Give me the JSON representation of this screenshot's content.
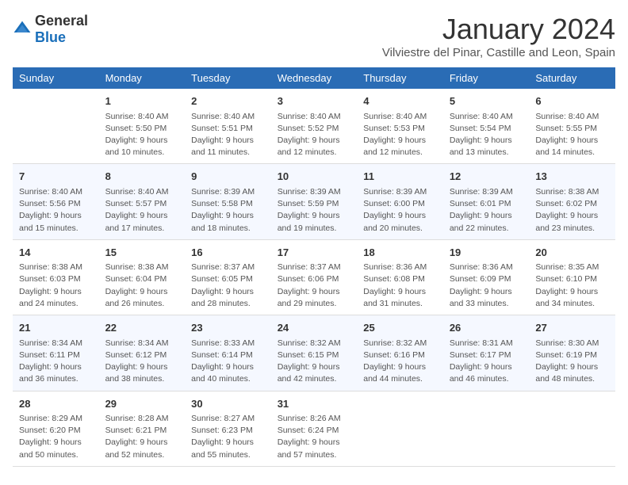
{
  "header": {
    "logo_general": "General",
    "logo_blue": "Blue",
    "month": "January 2024",
    "location": "Vilviestre del Pinar, Castille and Leon, Spain"
  },
  "weekdays": [
    "Sunday",
    "Monday",
    "Tuesday",
    "Wednesday",
    "Thursday",
    "Friday",
    "Saturday"
  ],
  "weeks": [
    [
      {
        "day": "",
        "info": ""
      },
      {
        "day": "1",
        "info": "Sunrise: 8:40 AM\nSunset: 5:50 PM\nDaylight: 9 hours\nand 10 minutes."
      },
      {
        "day": "2",
        "info": "Sunrise: 8:40 AM\nSunset: 5:51 PM\nDaylight: 9 hours\nand 11 minutes."
      },
      {
        "day": "3",
        "info": "Sunrise: 8:40 AM\nSunset: 5:52 PM\nDaylight: 9 hours\nand 12 minutes."
      },
      {
        "day": "4",
        "info": "Sunrise: 8:40 AM\nSunset: 5:53 PM\nDaylight: 9 hours\nand 12 minutes."
      },
      {
        "day": "5",
        "info": "Sunrise: 8:40 AM\nSunset: 5:54 PM\nDaylight: 9 hours\nand 13 minutes."
      },
      {
        "day": "6",
        "info": "Sunrise: 8:40 AM\nSunset: 5:55 PM\nDaylight: 9 hours\nand 14 minutes."
      }
    ],
    [
      {
        "day": "7",
        "info": "Sunrise: 8:40 AM\nSunset: 5:56 PM\nDaylight: 9 hours\nand 15 minutes."
      },
      {
        "day": "8",
        "info": "Sunrise: 8:40 AM\nSunset: 5:57 PM\nDaylight: 9 hours\nand 17 minutes."
      },
      {
        "day": "9",
        "info": "Sunrise: 8:39 AM\nSunset: 5:58 PM\nDaylight: 9 hours\nand 18 minutes."
      },
      {
        "day": "10",
        "info": "Sunrise: 8:39 AM\nSunset: 5:59 PM\nDaylight: 9 hours\nand 19 minutes."
      },
      {
        "day": "11",
        "info": "Sunrise: 8:39 AM\nSunset: 6:00 PM\nDaylight: 9 hours\nand 20 minutes."
      },
      {
        "day": "12",
        "info": "Sunrise: 8:39 AM\nSunset: 6:01 PM\nDaylight: 9 hours\nand 22 minutes."
      },
      {
        "day": "13",
        "info": "Sunrise: 8:38 AM\nSunset: 6:02 PM\nDaylight: 9 hours\nand 23 minutes."
      }
    ],
    [
      {
        "day": "14",
        "info": "Sunrise: 8:38 AM\nSunset: 6:03 PM\nDaylight: 9 hours\nand 24 minutes."
      },
      {
        "day": "15",
        "info": "Sunrise: 8:38 AM\nSunset: 6:04 PM\nDaylight: 9 hours\nand 26 minutes."
      },
      {
        "day": "16",
        "info": "Sunrise: 8:37 AM\nSunset: 6:05 PM\nDaylight: 9 hours\nand 28 minutes."
      },
      {
        "day": "17",
        "info": "Sunrise: 8:37 AM\nSunset: 6:06 PM\nDaylight: 9 hours\nand 29 minutes."
      },
      {
        "day": "18",
        "info": "Sunrise: 8:36 AM\nSunset: 6:08 PM\nDaylight: 9 hours\nand 31 minutes."
      },
      {
        "day": "19",
        "info": "Sunrise: 8:36 AM\nSunset: 6:09 PM\nDaylight: 9 hours\nand 33 minutes."
      },
      {
        "day": "20",
        "info": "Sunrise: 8:35 AM\nSunset: 6:10 PM\nDaylight: 9 hours\nand 34 minutes."
      }
    ],
    [
      {
        "day": "21",
        "info": "Sunrise: 8:34 AM\nSunset: 6:11 PM\nDaylight: 9 hours\nand 36 minutes."
      },
      {
        "day": "22",
        "info": "Sunrise: 8:34 AM\nSunset: 6:12 PM\nDaylight: 9 hours\nand 38 minutes."
      },
      {
        "day": "23",
        "info": "Sunrise: 8:33 AM\nSunset: 6:14 PM\nDaylight: 9 hours\nand 40 minutes."
      },
      {
        "day": "24",
        "info": "Sunrise: 8:32 AM\nSunset: 6:15 PM\nDaylight: 9 hours\nand 42 minutes."
      },
      {
        "day": "25",
        "info": "Sunrise: 8:32 AM\nSunset: 6:16 PM\nDaylight: 9 hours\nand 44 minutes."
      },
      {
        "day": "26",
        "info": "Sunrise: 8:31 AM\nSunset: 6:17 PM\nDaylight: 9 hours\nand 46 minutes."
      },
      {
        "day": "27",
        "info": "Sunrise: 8:30 AM\nSunset: 6:19 PM\nDaylight: 9 hours\nand 48 minutes."
      }
    ],
    [
      {
        "day": "28",
        "info": "Sunrise: 8:29 AM\nSunset: 6:20 PM\nDaylight: 9 hours\nand 50 minutes."
      },
      {
        "day": "29",
        "info": "Sunrise: 8:28 AM\nSunset: 6:21 PM\nDaylight: 9 hours\nand 52 minutes."
      },
      {
        "day": "30",
        "info": "Sunrise: 8:27 AM\nSunset: 6:23 PM\nDaylight: 9 hours\nand 55 minutes."
      },
      {
        "day": "31",
        "info": "Sunrise: 8:26 AM\nSunset: 6:24 PM\nDaylight: 9 hours\nand 57 minutes."
      },
      {
        "day": "",
        "info": ""
      },
      {
        "day": "",
        "info": ""
      },
      {
        "day": "",
        "info": ""
      }
    ]
  ]
}
